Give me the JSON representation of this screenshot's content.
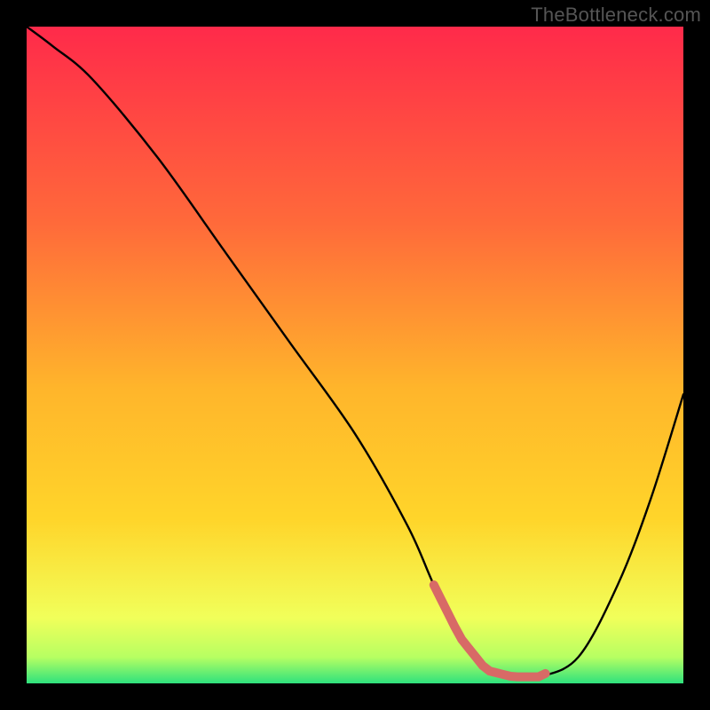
{
  "watermark": "TheBottleneck.com",
  "colors": {
    "frame": "#000000",
    "watermark": "#555555",
    "curve": "#000000",
    "highlight": "#d86a66",
    "gradient_top": "#ff2a4a",
    "gradient_mid": "#ffd52a",
    "gradient_bottom": "#2fe27d"
  },
  "chart_data": {
    "type": "line",
    "title": "",
    "xlabel": "",
    "ylabel": "",
    "xlim": [
      0,
      100
    ],
    "ylim": [
      0,
      100
    ],
    "x": [
      0,
      4,
      10,
      20,
      30,
      40,
      50,
      58,
      62,
      66,
      70,
      74,
      78,
      84,
      90,
      95,
      100
    ],
    "values": [
      100,
      97,
      92,
      80,
      66,
      52,
      38,
      24,
      15,
      7,
      2,
      1,
      1,
      4,
      15,
      28,
      44
    ],
    "highlight_range_x": [
      62,
      79
    ],
    "annotations": []
  }
}
